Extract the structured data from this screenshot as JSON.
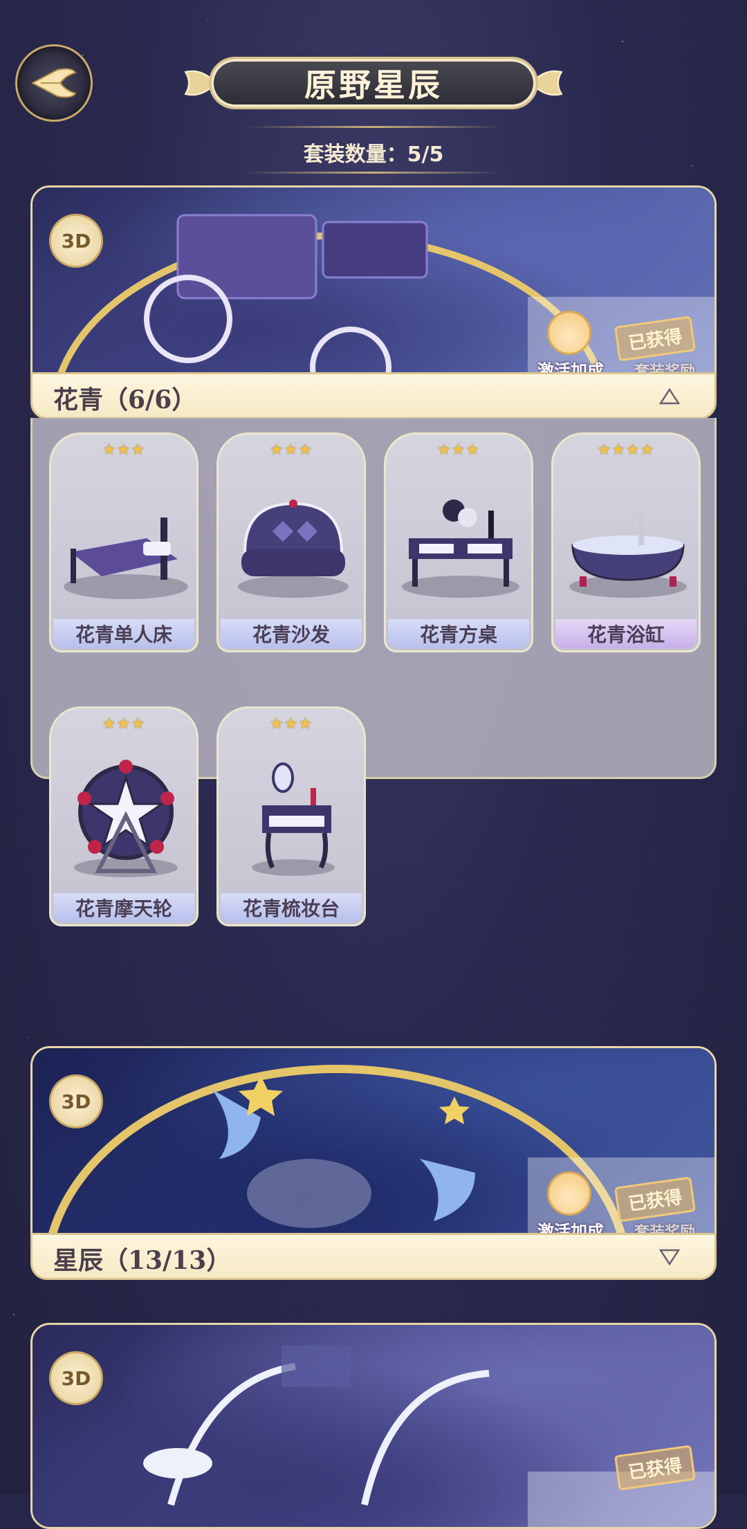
{
  "header": {
    "title": "原野星辰",
    "set_count": "套装数量：5/5"
  },
  "sets": [
    {
      "badge": "3D",
      "name": "花青（6/6）",
      "expanded": true,
      "boost_label": "激活加成",
      "owned_label": "已获得",
      "reward_label": "套装奖励",
      "items": [
        {
          "name": "花青单人床",
          "stars": "★★★"
        },
        {
          "name": "花青沙发",
          "stars": "★★★"
        },
        {
          "name": "花青方桌",
          "stars": "★★★"
        },
        {
          "name": "花青浴缸",
          "stars": "★★★★"
        },
        {
          "name": "花青摩天轮",
          "stars": "★★★"
        },
        {
          "name": "花青梳妆台",
          "stars": "★★★"
        }
      ]
    },
    {
      "badge": "3D",
      "name": "星辰（13/13）",
      "expanded": false,
      "boost_label": "激活加成",
      "owned_label": "已获得",
      "reward_label": "套装奖励"
    },
    {
      "badge": "3D",
      "owned_label": "已获得"
    }
  ],
  "colors": {
    "accent_gold": "#d7c08a",
    "bg_night": "#2a2a50",
    "name_tag_blue": "#b8c0ec",
    "name_tag_purple": "#c7b0ea"
  },
  "icons": {
    "back": "back-wing-icon",
    "collapse": "triangle-up-icon",
    "expand": "triangle-down-icon"
  }
}
